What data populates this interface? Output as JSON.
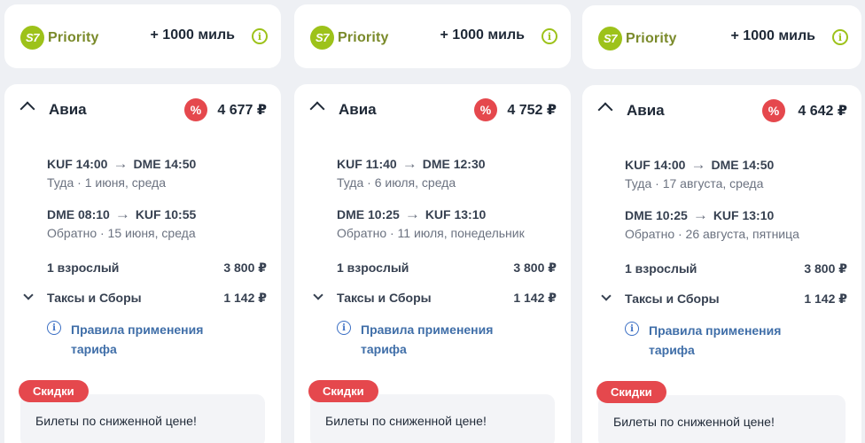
{
  "cards": [
    {
      "priority": {
        "brand": "Priority",
        "logo_text": "S7",
        "miles": "+ 1000 миль"
      },
      "section": "Авиа",
      "total_price": "4 677 ₽",
      "outbound": {
        "from": "KUF 14:00",
        "to": "DME 14:50",
        "sub": "Туда · 1 июня, среда"
      },
      "inbound": {
        "from": "DME 08:10",
        "to": "KUF 10:55",
        "sub": "Обратно · 15 июня, среда"
      },
      "passengers": {
        "label": "1 взрослый",
        "price": "3 800 ₽"
      },
      "taxes": {
        "label": "Таксы и Сборы",
        "price": "1 142 ₽"
      },
      "rules": "Правила применения тарифа",
      "discount": {
        "badge": "Скидки",
        "text": "Билеты по сниженной цене!"
      }
    },
    {
      "priority": {
        "brand": "Priority",
        "logo_text": "S7",
        "miles": "+ 1000 миль"
      },
      "section": "Авиа",
      "total_price": "4 752 ₽",
      "outbound": {
        "from": "KUF 11:40",
        "to": "DME 12:30",
        "sub": "Туда · 6 июля, среда"
      },
      "inbound": {
        "from": "DME 10:25",
        "to": "KUF 13:10",
        "sub": "Обратно · 11 июля, понедельник"
      },
      "passengers": {
        "label": "1 взрослый",
        "price": "3 800 ₽"
      },
      "taxes": {
        "label": "Таксы и Сборы",
        "price": "1 142 ₽"
      },
      "rules": "Правила применения тарифа",
      "discount": {
        "badge": "Скидки",
        "text": "Билеты по сниженной цене!"
      }
    },
    {
      "priority": {
        "brand": "Priority",
        "logo_text": "S7",
        "miles": "+ 1000 миль"
      },
      "section": "Авиа",
      "total_price": "4 642 ₽",
      "outbound": {
        "from": "KUF 14:00",
        "to": "DME 14:50",
        "sub": "Туда · 17 августа, среда"
      },
      "inbound": {
        "from": "DME 10:25",
        "to": "KUF 13:10",
        "sub": "Обратно · 26 августа, пятница"
      },
      "passengers": {
        "label": "1 взрослый",
        "price": "3 800 ₽"
      },
      "taxes": {
        "label": "Таксы и Сборы",
        "price": "1 142 ₽"
      },
      "rules": "Правила применения тарифа",
      "discount": {
        "badge": "Скидки",
        "text": "Билеты по сниженной цене!"
      }
    }
  ],
  "icons": {
    "discount_symbol": "%",
    "info_symbol": "i",
    "arrow_symbol": "→"
  },
  "colors": {
    "brand_green": "#9dc21a",
    "discount_red": "#e5484d",
    "link_blue": "#3f6ea8"
  }
}
